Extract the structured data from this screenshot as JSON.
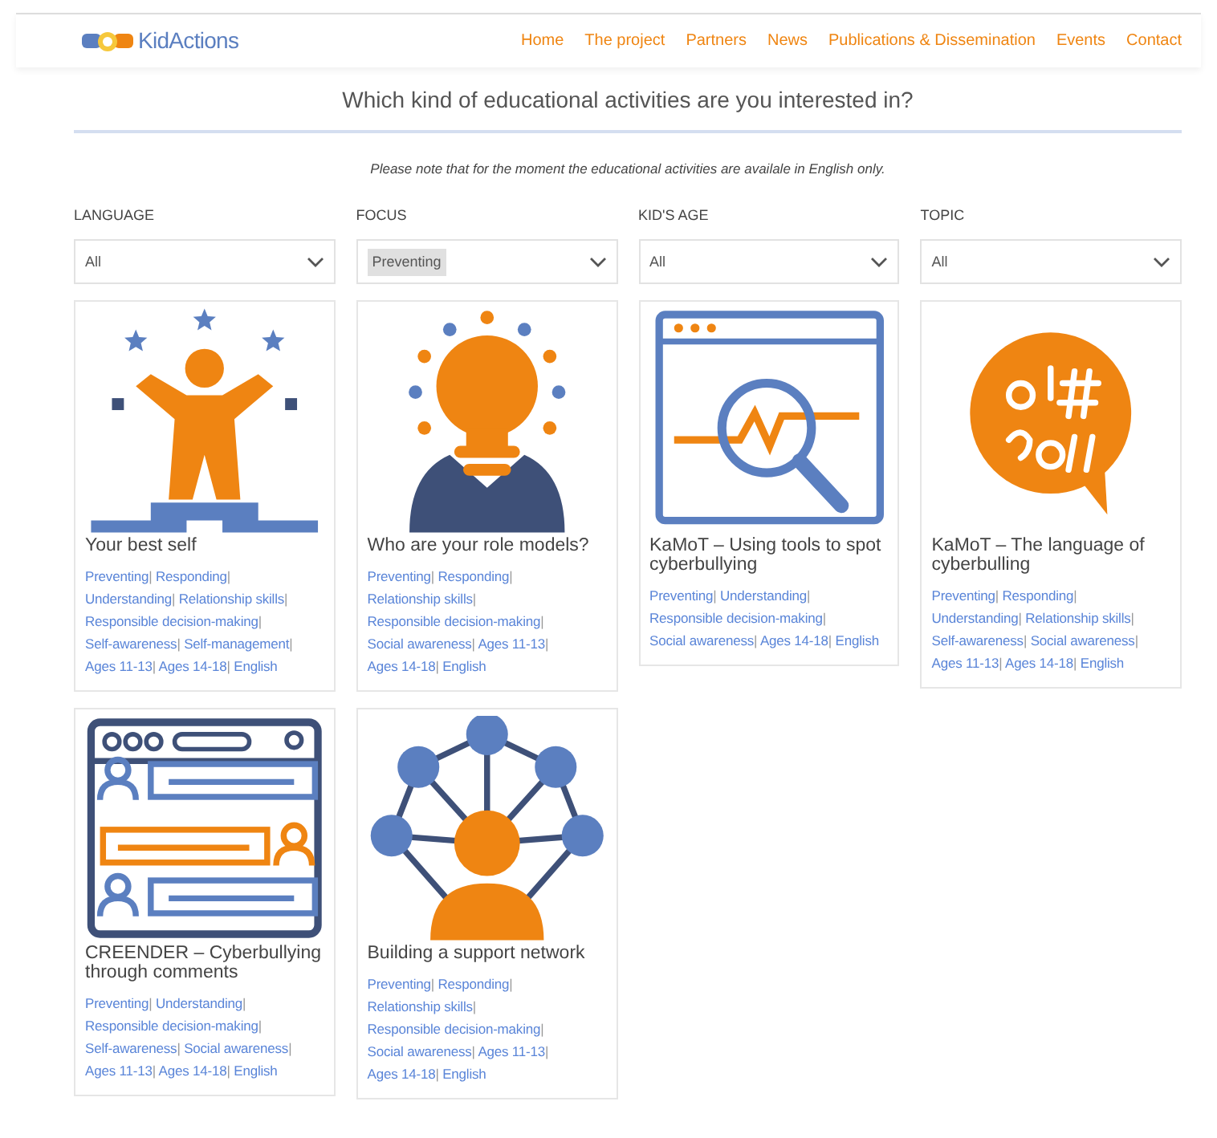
{
  "logo": {
    "text": "KidActions"
  },
  "nav": [
    {
      "label": "Home"
    },
    {
      "label": "The project"
    },
    {
      "label": "Partners"
    },
    {
      "label": "News"
    },
    {
      "label": "Publications & Dissemination"
    },
    {
      "label": "Events"
    },
    {
      "label": "Contact"
    }
  ],
  "heading": "Which kind of educational activities are you interested in?",
  "note": "Please note that for the moment the educational activities are availale in English only.",
  "filters": [
    {
      "label": "LANGUAGE",
      "value": "All",
      "highlighted": false
    },
    {
      "label": "FOCUS",
      "value": "Preventing",
      "highlighted": true
    },
    {
      "label": "KID'S AGE",
      "value": "All",
      "highlighted": false
    },
    {
      "label": "TOPIC",
      "value": "All",
      "highlighted": false
    }
  ],
  "tag_separator": "|",
  "cards": [
    {
      "kind": "podium",
      "title": "Your best self",
      "tags": [
        "Preventing",
        "Responding",
        "Understanding",
        "Relationship skills",
        "Responsible decision-making",
        "Self-awareness",
        "Self-management",
        "Ages 11-13",
        "Ages 14-18",
        "English"
      ]
    },
    {
      "kind": "lightbulb",
      "title": "Who are your role models?",
      "tags": [
        "Preventing",
        "Responding",
        "Relationship skills",
        "Responsible decision-making",
        "Social awareness",
        "Ages 11-13",
        "Ages 14-18",
        "English"
      ]
    },
    {
      "kind": "magnifier",
      "title": "KaMoT – Using tools to spot cyberbullying",
      "tags": [
        "Preventing",
        "Understanding",
        "Responsible decision-making",
        "Social awareness",
        "Ages 14-18",
        "English"
      ]
    },
    {
      "kind": "speech",
      "title": "KaMoT – The language of cyberbulling",
      "tags": [
        "Preventing",
        "Responding",
        "Understanding",
        "Relationship skills",
        "Self-awareness",
        "Social awareness",
        "Ages 11-13",
        "Ages 14-18",
        "English"
      ]
    },
    {
      "kind": "chat",
      "title": "CREENDER – Cyberbullying through comments",
      "tags": [
        "Preventing",
        "Understanding",
        "Responsible decision-making",
        "Self-awareness",
        "Social awareness",
        "Ages 11-13",
        "Ages 14-18",
        "English"
      ]
    },
    {
      "kind": "network",
      "title": "Building a support network",
      "tags": [
        "Preventing",
        "Responding",
        "Relationship skills",
        "Responsible decision-making",
        "Social awareness",
        "Ages 11-13",
        "Ages 14-18",
        "English"
      ]
    }
  ]
}
